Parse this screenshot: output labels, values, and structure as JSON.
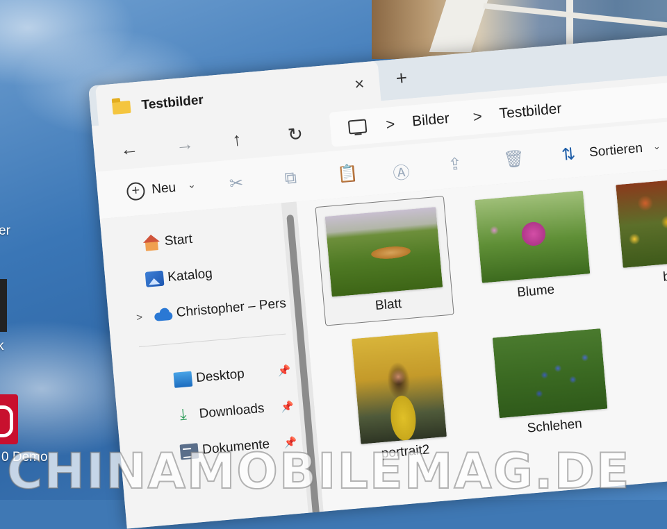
{
  "desktop": {
    "label_er": "er",
    "label_k": "k",
    "label_demo": "0 Demo"
  },
  "window": {
    "tab": {
      "title": "Testbilder",
      "close": "×"
    },
    "new_tab": "+",
    "nav": {
      "back": "←",
      "forward": "→",
      "up": "↑",
      "refresh": "↻"
    },
    "address": {
      "separator": ">",
      "crumbs": [
        "Bilder",
        "Testbilder"
      ]
    },
    "toolbar": {
      "new_label": "Neu",
      "new_plus": "+",
      "chevron": "⌄",
      "cut": "✂",
      "copy": "⧉",
      "paste": "📋",
      "rename": "Ⓐ",
      "share": "⇪",
      "delete": "🗑",
      "sort_label": "Sortieren",
      "sort_icon": "⇅"
    },
    "sidebar": {
      "items": [
        {
          "label": "Start",
          "icon": "home-icon"
        },
        {
          "label": "Katalog",
          "icon": "gallery-icon"
        },
        {
          "label": "Christopher – Pers",
          "icon": "onedrive-cloud-icon",
          "expander": ">"
        },
        {
          "label": "Desktop",
          "icon": "desktop-icon",
          "pinned": true
        },
        {
          "label": "Downloads",
          "icon": "download-icon",
          "pinned": true
        },
        {
          "label": "Dokumente",
          "icon": "documents-icon",
          "pinned": true
        }
      ],
      "pin_glyph": "📌"
    },
    "files": [
      {
        "name": "Blatt",
        "selected": true
      },
      {
        "name": "Blume",
        "selected": false
      },
      {
        "name": "blume",
        "selected": false
      },
      {
        "name": "portrait2",
        "selected": false
      },
      {
        "name": "Schlehen",
        "selected": false
      }
    ]
  },
  "watermark": "CHINAMOBILEMAG.DE"
}
